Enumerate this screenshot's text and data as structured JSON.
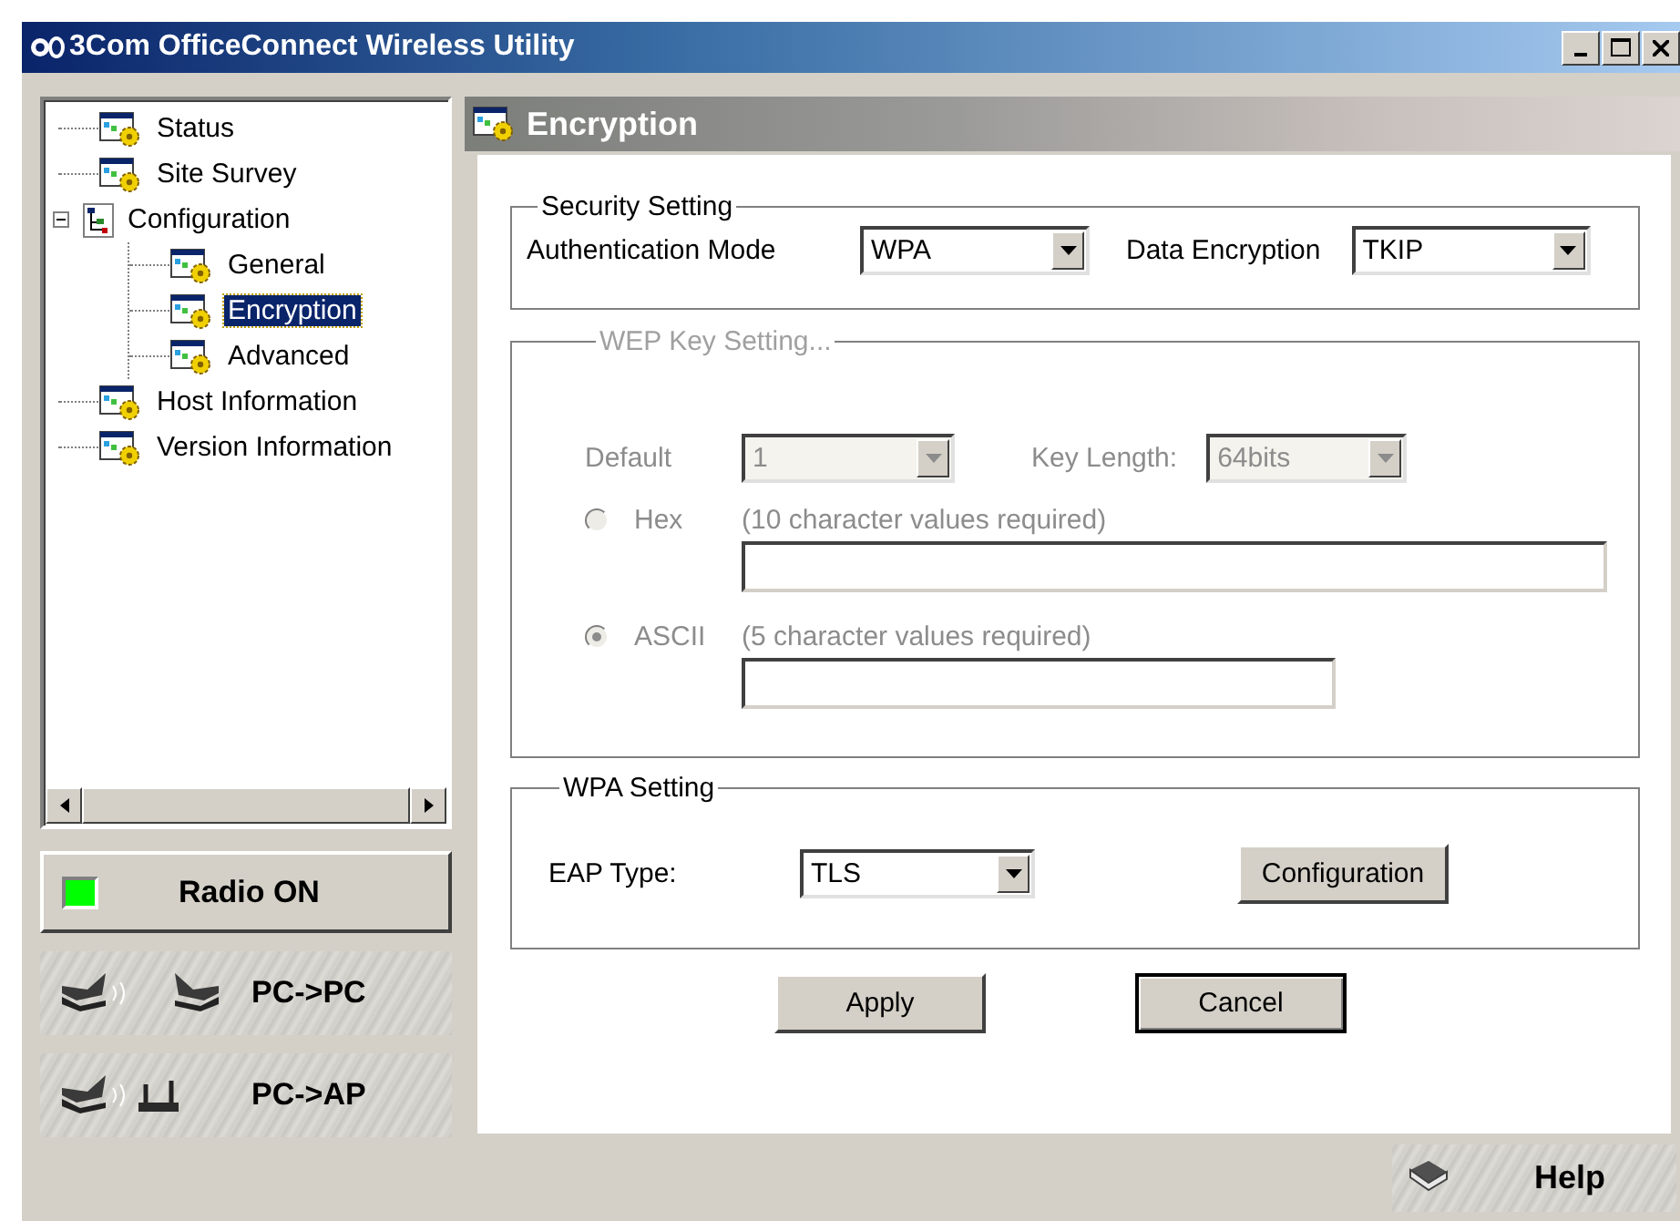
{
  "window": {
    "title": "3Com OfficeConnect Wireless Utility"
  },
  "tree": {
    "items": [
      {
        "label": "Status",
        "selected": false
      },
      {
        "label": "Site Survey",
        "selected": false
      },
      {
        "label": "Configuration",
        "selected": false,
        "expanded": true,
        "children": [
          {
            "label": "General",
            "selected": false
          },
          {
            "label": "Encryption",
            "selected": true
          },
          {
            "label": "Advanced",
            "selected": false
          }
        ]
      },
      {
        "label": "Host Information",
        "selected": false
      },
      {
        "label": "Version Information",
        "selected": false
      }
    ]
  },
  "radio_button": {
    "label": "Radio ON",
    "on": true
  },
  "mode_buttons": [
    {
      "label": "PC->PC",
      "kind": "pc"
    },
    {
      "label": "PC->AP",
      "kind": "ap"
    }
  ],
  "panel": {
    "title": "Encryption"
  },
  "security_setting": {
    "title": "Security Setting",
    "fields": [
      {
        "label": "Authentication Mode",
        "value": "WPA"
      },
      {
        "label": "Data Encryption",
        "value": "TKIP"
      }
    ]
  },
  "wep_key_setting": {
    "title": "WEP Key Setting...",
    "disabled": true,
    "default": {
      "label": "Default",
      "value": "1"
    },
    "key_length": {
      "label": "Key Length:",
      "value": "64bits"
    },
    "formats": [
      {
        "label": "Hex",
        "hint": "(10 character values required)",
        "selected": false
      },
      {
        "label": "ASCII",
        "hint": "(5 character values required)",
        "selected": true
      }
    ]
  },
  "wpa_setting": {
    "title": "WPA Setting",
    "eap_type": {
      "label": "EAP Type:",
      "value": "TLS"
    },
    "button": "Configuration"
  },
  "buttons": [
    {
      "label": "Apply",
      "default": false
    },
    {
      "label": "Cancel",
      "default": true
    }
  ],
  "help_button": {
    "label": "Help"
  }
}
